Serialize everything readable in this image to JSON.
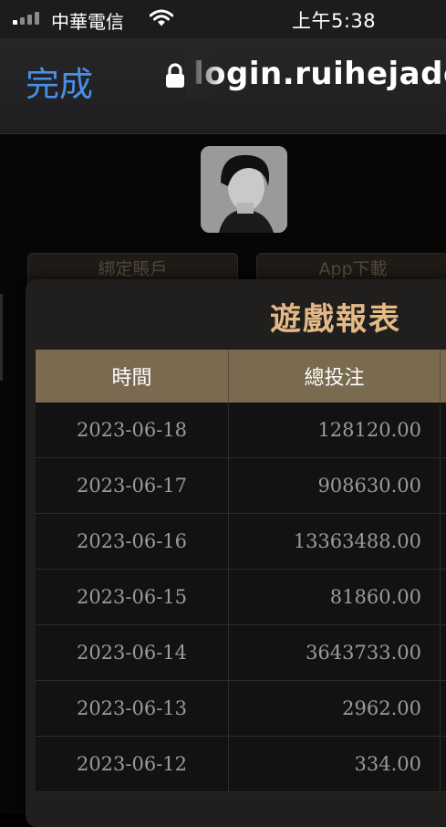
{
  "status_bar": {
    "carrier": "中華電信",
    "time": "上午5:38"
  },
  "browser": {
    "done_label": "完成",
    "url": "login.ruihejade.com"
  },
  "page": {
    "bg_button_left": "綁定賬戶",
    "bg_button_right": "App下載"
  },
  "modal": {
    "title": "遊戲報表",
    "columns": [
      "時間",
      "總投注"
    ],
    "rows": [
      {
        "date": "2023-06-18",
        "total": "128120.00"
      },
      {
        "date": "2023-06-17",
        "total": "908630.00"
      },
      {
        "date": "2023-06-16",
        "total": "13363488.00"
      },
      {
        "date": "2023-06-15",
        "total": "81860.00"
      },
      {
        "date": "2023-06-14",
        "total": "3643733.00"
      },
      {
        "date": "2023-06-13",
        "total": "2962.00"
      },
      {
        "date": "2023-06-12",
        "total": "334.00"
      }
    ]
  },
  "colors": {
    "accent_title": "#e4b986",
    "header_bg": "#7a6a50",
    "done_blue": "#4a8fe7"
  }
}
